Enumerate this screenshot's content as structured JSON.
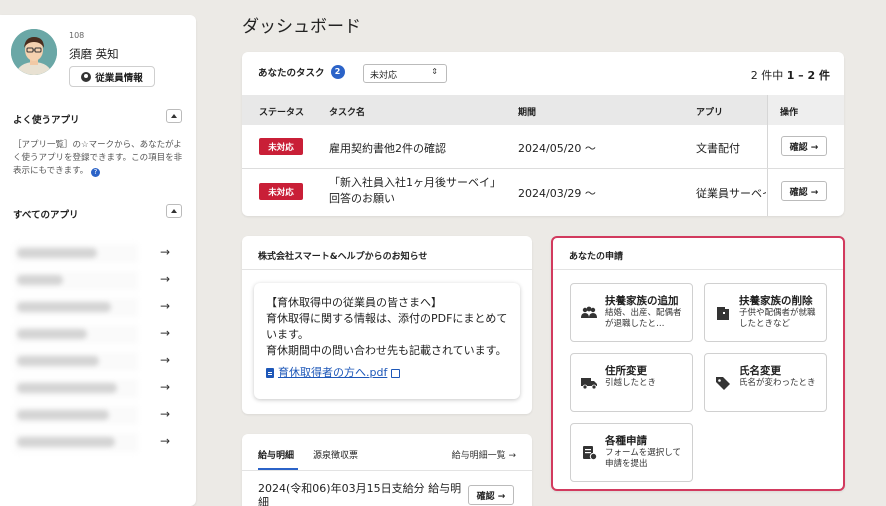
{
  "profile": {
    "employee_number": "108",
    "name": "須磨 英知",
    "info_button": "従業員情報"
  },
  "favorites": {
    "title": "よく使うアプリ",
    "note": "［アプリ一覧］の☆マークから、あなたがよく使うアプリを登録できます。この項目を非表示にもできます。",
    "help": "?"
  },
  "all_apps": {
    "title": "すべてのアプリ",
    "arrow": "→",
    "rows": [
      {
        "blur_width": 80
      },
      {
        "blur_width": 46
      },
      {
        "blur_width": 94
      },
      {
        "blur_width": 70
      },
      {
        "blur_width": 82
      },
      {
        "blur_width": 100
      },
      {
        "blur_width": 92
      },
      {
        "blur_width": 98
      }
    ]
  },
  "page_title": "ダッシュボード",
  "tasks": {
    "title": "あなたのタスク",
    "count": "2",
    "filter": "未対応",
    "filter_chevron": "⇕",
    "pager_total": "2 件中",
    "pager_range": "1 – 2 件",
    "columns": [
      "ステータス",
      "タスク名",
      "期間",
      "アプリ",
      "操作"
    ],
    "rows": [
      {
        "status": "未対応",
        "name": "雇用契約書他2件の確認",
        "period": "2024/05/20 ～",
        "app": "文書配付",
        "action": "確認 →"
      },
      {
        "status": "未対応",
        "name": "「新入社員入社1ヶ月後サーベイ」回答のお願い",
        "period": "2024/03/29 ～",
        "app": "従業員サーベイ",
        "action": "確認 →"
      }
    ]
  },
  "notice": {
    "title": "株式会社スマート&ヘルプからのお知らせ",
    "line1": "【育休取得中の従業員の皆さまへ】",
    "line2": "育休取得に関する情報は、添付のPDFにまとめています。",
    "line3": "育休期間中の問い合わせ先も記載されています。",
    "link": "育休取得者の方へ.pdf"
  },
  "payslip": {
    "tab_active": "給与明細",
    "tab_other": "源泉徴収票",
    "list_link": "給与明細一覧 →",
    "item": "2024(令和06)年03月15日支給分 給与明細",
    "action": "確認 →"
  },
  "applications": {
    "title": "あなたの申請",
    "tiles": [
      {
        "title": "扶養家族の追加",
        "desc": "結婚、出産、配偶者が退職したと…",
        "icon": "family-add-icon"
      },
      {
        "title": "扶養家族の削除",
        "desc": "子供や配偶者が就職したときなど",
        "icon": "family-remove-icon"
      },
      {
        "title": "住所変更",
        "desc": "引越したとき",
        "icon": "truck-icon"
      },
      {
        "title": "氏名変更",
        "desc": "氏名が変わったとき",
        "icon": "tag-icon"
      },
      {
        "title": "各種申請",
        "desc": "フォームを選択して申請を提出",
        "icon": "form-icon"
      }
    ]
  },
  "colors": {
    "accent": "#2b63c8",
    "status_red": "#c91f37",
    "highlight_border": "#d23a5e"
  }
}
